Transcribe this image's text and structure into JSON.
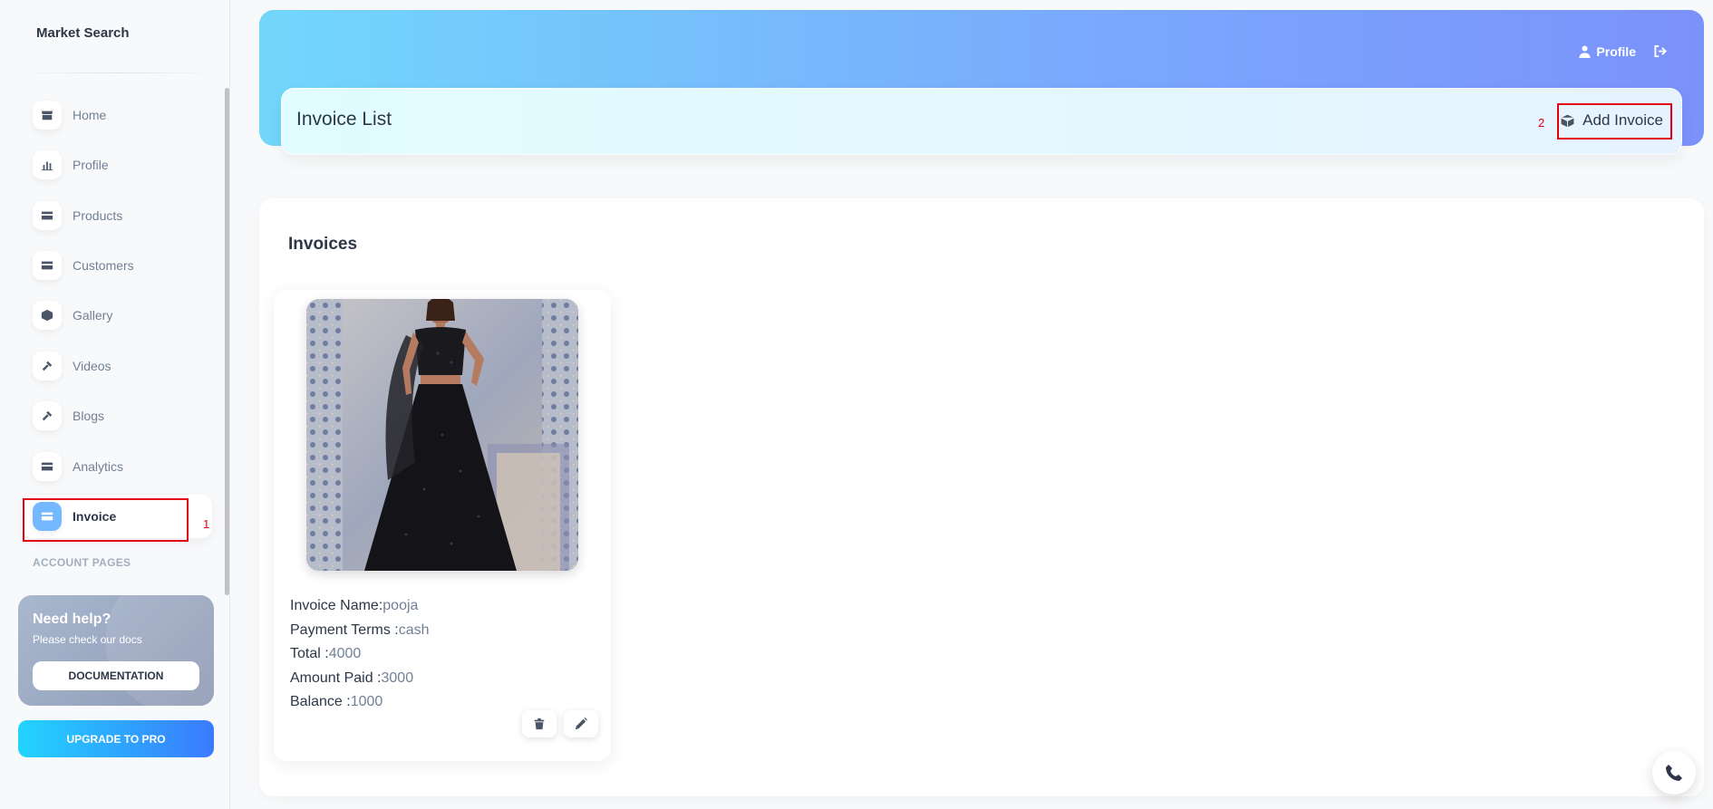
{
  "brand": "Market Search",
  "sidebar": {
    "items": [
      {
        "label": "Home",
        "icon": "store-icon"
      },
      {
        "label": "Profile",
        "icon": "chart-icon"
      },
      {
        "label": "Products",
        "icon": "card-icon"
      },
      {
        "label": "Customers",
        "icon": "card-icon"
      },
      {
        "label": "Gallery",
        "icon": "cube-icon"
      },
      {
        "label": "Videos",
        "icon": "tools-icon"
      },
      {
        "label": "Blogs",
        "icon": "tools-icon"
      },
      {
        "label": "Analytics",
        "icon": "card-icon"
      },
      {
        "label": "Invoice",
        "icon": "card-icon",
        "active": true
      }
    ],
    "section_title": "ACCOUNT PAGES",
    "annotation_1": "1",
    "help": {
      "title": "Need help?",
      "subtitle": "Please check our docs",
      "button": "DOCUMENTATION"
    },
    "upgrade": "UPGRADE TO PRO"
  },
  "header": {
    "profile_label": "Profile",
    "page_title": "Invoice List",
    "add_button": "Add Invoice",
    "annotation_2": "2"
  },
  "main": {
    "title": "Invoices",
    "invoices": [
      {
        "name_label": "Invoice Name:",
        "name": "pooja",
        "terms_label": "Payment Terms :",
        "terms": "cash",
        "total_label": "Total :",
        "total": "4000",
        "paid_label": "Amount Paid :",
        "paid": "3000",
        "balance_label": "Balance :",
        "balance": "1000"
      }
    ]
  },
  "colors": {
    "accent": "#74b9ff",
    "annotation": "#e3000f",
    "header_gradient_start": "#72d7fb",
    "header_gradient_end": "#7b92fb"
  }
}
